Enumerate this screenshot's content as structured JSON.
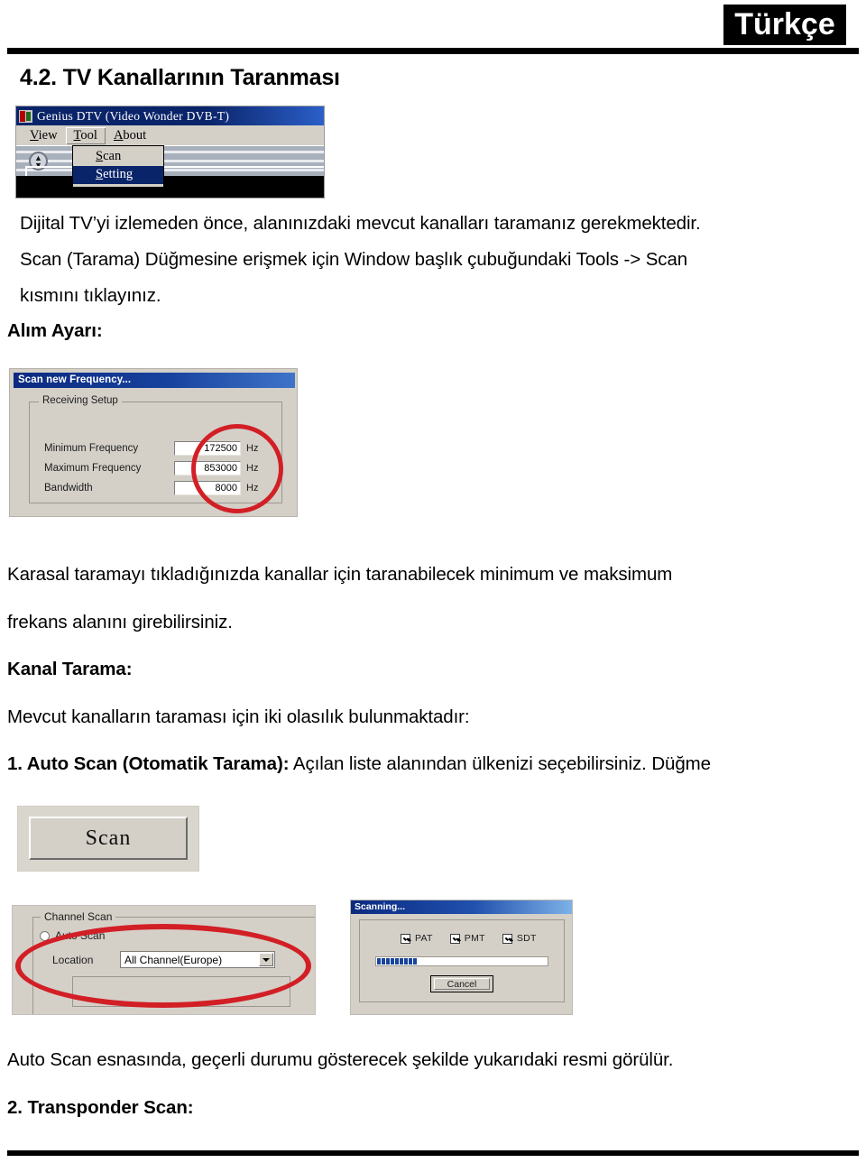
{
  "page": {
    "language_badge": "Türkçe",
    "section_heading": "4.2. TV Kanallarının Taranması"
  },
  "paragraphs": {
    "intro_line1": "Dijital TV’yi izlemeden önce, alanınızdaki mevcut kanalları taramanız gerekmektedir.",
    "intro_line2": "Scan (Tarama) Düğmesine erişmek için Window başlık çubuğundaki Tools -> Scan",
    "intro_line3": "kısmını tıklayınız.",
    "heading_alim_ayari": "Alım Ayarı:",
    "freq_line1": "Karasal taramayı tıkladığınızda kanallar için taranabilecek minimum ve maksimum",
    "freq_line2": "frekans alanını girebilirsiniz.",
    "heading_kanal_tarama": "Kanal Tarama:",
    "kanal_line1": "Mevcut kanalların taraması için iki olasılık bulunmaktadır:",
    "item1_bold": "1. Auto Scan (Otomatik Tarama):",
    "item1_rest": " Açılan liste alanından ülkenizi seçebilirsiniz. Düğme",
    "autoscan_note": "Auto Scan esnasında, geçerli durumu gösterecek şekilde yukarıdaki resmi görülür.",
    "item2_bold": "2. Transponder Scan:"
  },
  "screenshots": {
    "dtv_window": {
      "title": "Genius DTV (Video Wonder DVB-T)",
      "menus": [
        "View",
        "Tool",
        "About"
      ],
      "open_menu": "Tool",
      "dropdown_items": [
        {
          "label": "Scan",
          "selected": false
        },
        {
          "label": "Setting",
          "selected": true
        }
      ],
      "icon_names": [
        "app-icon",
        "spinner-knob-icon"
      ]
    },
    "scan_new_frequency": {
      "title": "Scan new Frequency...",
      "group_label": "Receiving Setup",
      "fields": [
        {
          "label": "Minimum Frequency",
          "value": "172500",
          "unit": "Hz"
        },
        {
          "label": "Maximum Frequency",
          "value": "853000",
          "unit": "Hz"
        },
        {
          "label": "Bandwidth",
          "value": "8000",
          "unit": "Hz"
        }
      ],
      "annotation_color": "#d21f26"
    },
    "scan_button": {
      "label": "Scan"
    },
    "channel_scan": {
      "group_label": "Channel Scan",
      "radio_label": "Auto Scan",
      "radio_checked": false,
      "location_label": "Location",
      "location_value": "All Channel(Europe)",
      "annotation_color": "#d21f26"
    },
    "scanning_dialog": {
      "title": "Scanning...",
      "checkboxes": [
        {
          "label": "PAT",
          "checked": true
        },
        {
          "label": "PMT",
          "checked": true
        },
        {
          "label": "SDT",
          "checked": true
        }
      ],
      "progress_segments": 9,
      "cancel_label": "Cancel"
    }
  }
}
